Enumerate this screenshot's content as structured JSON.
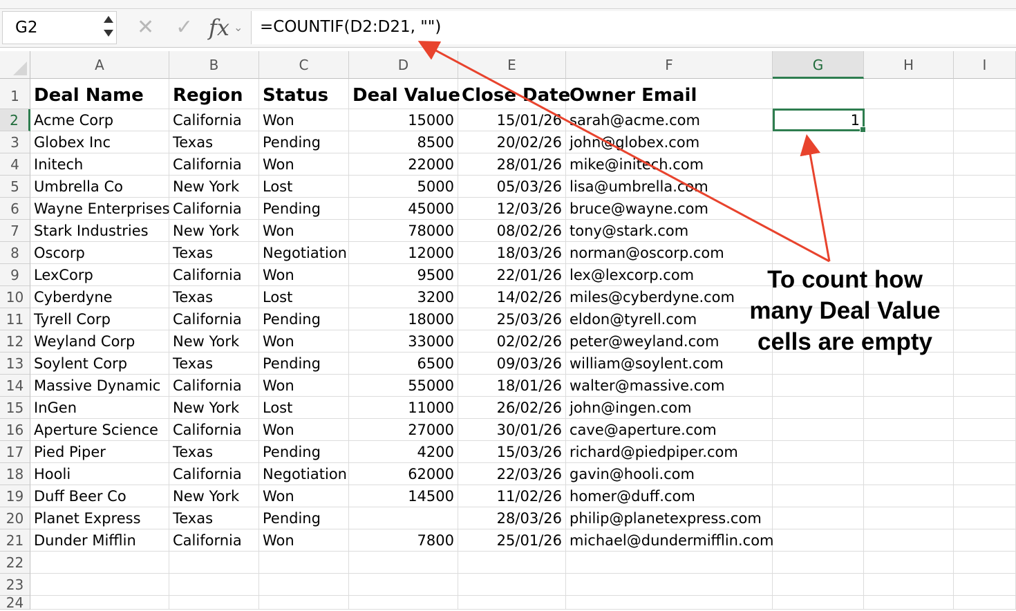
{
  "formula_bar": {
    "name_box": "G2",
    "cancel_icon": "✕",
    "enter_icon": "✓",
    "fx_label": "fx",
    "formula": "=COUNTIF(D2:D21, \"\")"
  },
  "columns": [
    "A",
    "B",
    "C",
    "D",
    "E",
    "F",
    "G",
    "H",
    "I"
  ],
  "active_column": "G",
  "active_row": 2,
  "rows": [
    {
      "n": "1",
      "cells": [
        "Deal Name",
        "Region",
        "Status",
        "Deal Value",
        "Close Date",
        "Owner Email",
        "",
        ""
      ]
    },
    {
      "n": "2",
      "cells": [
        "Acme Corp",
        "California",
        "Won",
        "15000",
        "15/01/26",
        "sarah@acme.com",
        "1",
        ""
      ]
    },
    {
      "n": "3",
      "cells": [
        "Globex Inc",
        "Texas",
        "Pending",
        "8500",
        "20/02/26",
        "john@globex.com",
        "",
        ""
      ]
    },
    {
      "n": "4",
      "cells": [
        "Initech",
        "California",
        "Won",
        "22000",
        "28/01/26",
        "mike@initech.com",
        "",
        ""
      ]
    },
    {
      "n": "5",
      "cells": [
        "Umbrella Co",
        "New York",
        "Lost",
        "5000",
        "05/03/26",
        "lisa@umbrella.com",
        "",
        ""
      ]
    },
    {
      "n": "6",
      "cells": [
        "Wayne Enterprises",
        "California",
        "Pending",
        "45000",
        "12/03/26",
        "bruce@wayne.com",
        "",
        ""
      ]
    },
    {
      "n": "7",
      "cells": [
        "Stark Industries",
        "New York",
        "Won",
        "78000",
        "08/02/26",
        "tony@stark.com",
        "",
        ""
      ]
    },
    {
      "n": "8",
      "cells": [
        "Oscorp",
        "Texas",
        "Negotiation",
        "12000",
        "18/03/26",
        "norman@oscorp.com",
        "",
        ""
      ]
    },
    {
      "n": "9",
      "cells": [
        "LexCorp",
        "California",
        "Won",
        "9500",
        "22/01/26",
        "lex@lexcorp.com",
        "",
        ""
      ]
    },
    {
      "n": "10",
      "cells": [
        "Cyberdyne",
        "Texas",
        "Lost",
        "3200",
        "14/02/26",
        "miles@cyberdyne.com",
        "",
        ""
      ]
    },
    {
      "n": "11",
      "cells": [
        "Tyrell Corp",
        "California",
        "Pending",
        "18000",
        "25/03/26",
        "eldon@tyrell.com",
        "",
        ""
      ]
    },
    {
      "n": "12",
      "cells": [
        "Weyland Corp",
        "New York",
        "Won",
        "33000",
        "02/02/26",
        "peter@weyland.com",
        "",
        ""
      ]
    },
    {
      "n": "13",
      "cells": [
        "Soylent Corp",
        "Texas",
        "Pending",
        "6500",
        "09/03/26",
        "william@soylent.com",
        "",
        ""
      ]
    },
    {
      "n": "14",
      "cells": [
        "Massive Dynamic",
        "California",
        "Won",
        "55000",
        "18/01/26",
        "walter@massive.com",
        "",
        ""
      ]
    },
    {
      "n": "15",
      "cells": [
        "InGen",
        "New York",
        "Lost",
        "11000",
        "26/02/26",
        "john@ingen.com",
        "",
        ""
      ]
    },
    {
      "n": "16",
      "cells": [
        "Aperture Science",
        "California",
        "Won",
        "27000",
        "30/01/26",
        "cave@aperture.com",
        "",
        ""
      ]
    },
    {
      "n": "17",
      "cells": [
        "Pied Piper",
        "Texas",
        "Pending",
        "4200",
        "15/03/26",
        "richard@piedpiper.com",
        "",
        ""
      ]
    },
    {
      "n": "18",
      "cells": [
        "Hooli",
        "California",
        "Negotiation",
        "62000",
        "22/03/26",
        "gavin@hooli.com",
        "",
        ""
      ]
    },
    {
      "n": "19",
      "cells": [
        "Duff Beer Co",
        "New York",
        "Won",
        "14500",
        "11/02/26",
        "homer@duff.com",
        "",
        ""
      ]
    },
    {
      "n": "20",
      "cells": [
        "Planet Express",
        "Texas",
        "Pending",
        "",
        "28/03/26",
        "philip@planetexpress.com",
        "",
        ""
      ]
    },
    {
      "n": "21",
      "cells": [
        "Dunder Mifflin",
        "California",
        "Won",
        "7800",
        "25/01/26",
        "michael@dundermifflin.com",
        "",
        ""
      ]
    },
    {
      "n": "22",
      "cells": [
        "",
        "",
        "",
        "",
        "",
        "",
        "",
        ""
      ]
    },
    {
      "n": "23",
      "cells": [
        "",
        "",
        "",
        "",
        "",
        "",
        "",
        ""
      ]
    },
    {
      "n": "24",
      "cells": [
        "",
        "",
        "",
        "",
        "",
        "",
        "",
        ""
      ]
    }
  ],
  "annotation": {
    "lines": [
      "To count how",
      "many Deal Value",
      "cells are empty"
    ],
    "arrow_color": "#e8432d"
  }
}
